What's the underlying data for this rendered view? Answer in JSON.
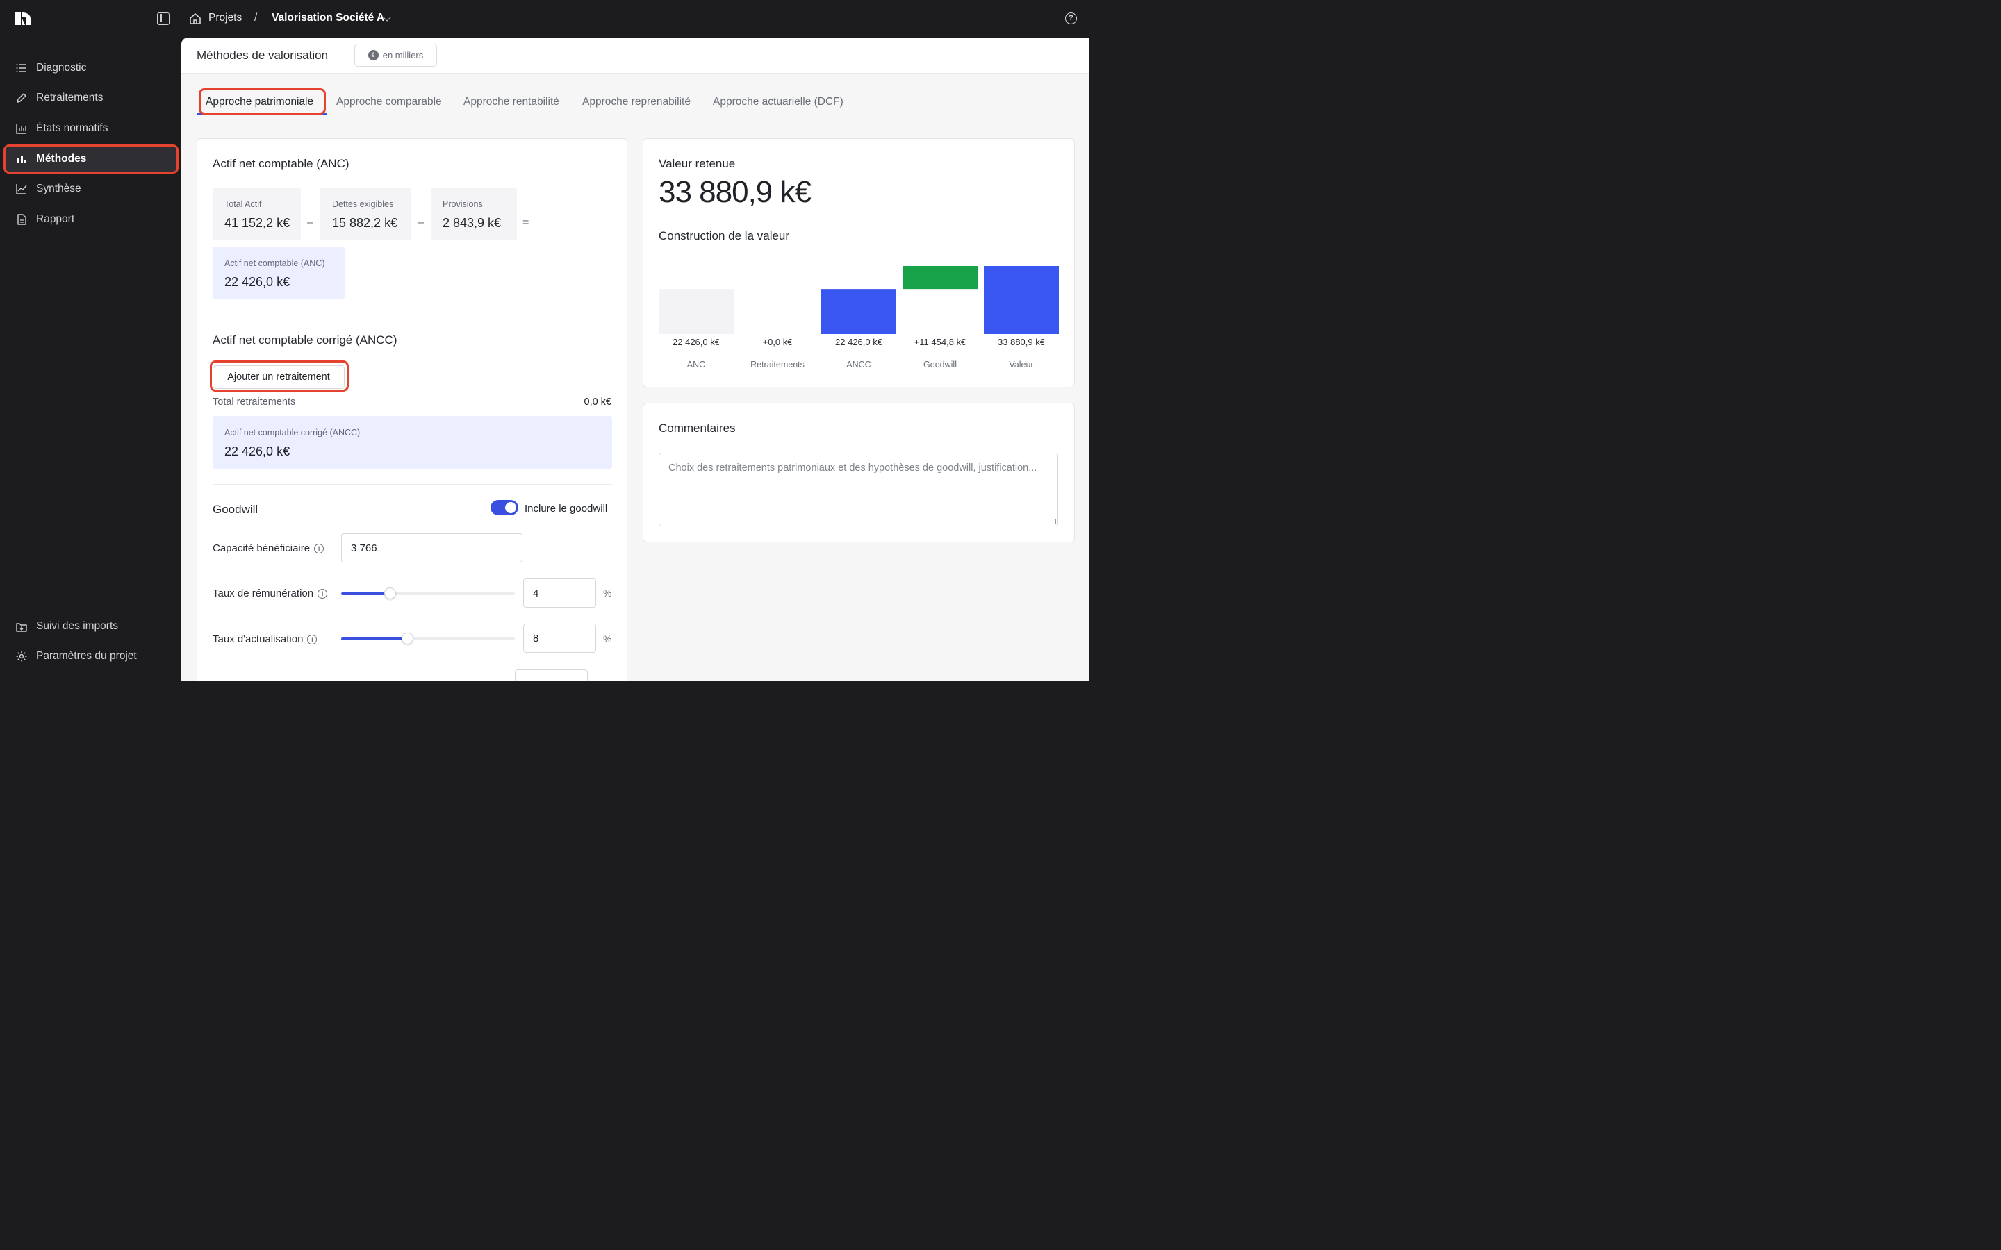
{
  "topbar": {
    "breadcrumb_projects": "Projets",
    "breadcrumb_sep": "/",
    "breadcrumb_current": "Valorisation Société A",
    "help_glyph": "?"
  },
  "sidebar": {
    "items": [
      {
        "label": "Diagnostic",
        "icon": "list-icon"
      },
      {
        "label": "Retraitements",
        "icon": "pencil-icon"
      },
      {
        "label": "États normatifs",
        "icon": "bar-chart-icon"
      },
      {
        "label": "Méthodes",
        "icon": "bar-chart-filled-icon",
        "active": true
      },
      {
        "label": "Synthèse",
        "icon": "line-chart-icon"
      },
      {
        "label": "Rapport",
        "icon": "document-icon"
      }
    ],
    "bottom_items": [
      {
        "label": "Suivi des imports",
        "icon": "import-icon"
      },
      {
        "label": "Paramètres du projet",
        "icon": "gear-icon"
      }
    ]
  },
  "header": {
    "title": "Méthodes de valorisation",
    "unit_symbol": "€",
    "unit_label": "en milliers"
  },
  "tabs": [
    {
      "label": "Approche patrimoniale",
      "active": true
    },
    {
      "label": "Approche comparable"
    },
    {
      "label": "Approche rentabilité"
    },
    {
      "label": "Approche reprenabilité"
    },
    {
      "label": "Approche actuarielle (DCF)"
    }
  ],
  "anc": {
    "title": "Actif net comptable (ANC)",
    "total_actif_label": "Total Actif",
    "total_actif_value": "41 152,2 k€",
    "dettes_label": "Dettes exigibles",
    "dettes_value": "15 882,2 k€",
    "provisions_label": "Provisions",
    "provisions_value": "2 843,9 k€",
    "op_minus": "–",
    "op_equals": "=",
    "result_label": "Actif net comptable (ANC)",
    "result_value": "22 426,0 k€"
  },
  "ancc": {
    "title": "Actif net comptable corrigé (ANCC)",
    "add_button": "Ajouter un retraitement",
    "total_label": "Total retraitements",
    "total_value": "0,0 k€",
    "result_label": "Actif net comptable corrigé (ANCC)",
    "result_value": "22 426,0 k€"
  },
  "goodwill": {
    "title": "Goodwill",
    "toggle_label": "Inclure le goodwill",
    "toggle_on": true,
    "capacite_label": "Capacité bénéficiaire",
    "capacite_value": "3 766",
    "taux_remu_label": "Taux de rémunération",
    "taux_remu_value": "4",
    "taux_remu_fraction": 0.28,
    "taux_actu_label": "Taux d'actualisation",
    "taux_actu_value": "8",
    "taux_actu_fraction": 0.38,
    "percent_sign": "%",
    "info_glyph": "i"
  },
  "valeur": {
    "title": "Valeur retenue",
    "value": "33 880,9 k€",
    "chart_title": "Construction de la valeur"
  },
  "chart_data": {
    "type": "waterfall",
    "title": "Construction de la valeur",
    "categories": [
      "ANC",
      "Retraitements",
      "ANCC",
      "Goodwill",
      "Valeur"
    ],
    "values": [
      22426.0,
      0.0,
      22426.0,
      11454.8,
      33880.9
    ],
    "labels": [
      "22 426,0 k€",
      "+0,0 k€",
      "22 426,0 k€",
      "+11 454,8 k€",
      "33 880,9 k€"
    ],
    "kinds": [
      "base",
      "delta",
      "total",
      "delta",
      "total"
    ],
    "colors": {
      "base": "#f3f3f5",
      "total": "#3a56f0",
      "delta": "#18a34a"
    },
    "ylim": [
      0,
      33880.9
    ]
  },
  "comments": {
    "title": "Commentaires",
    "placeholder": "Choix des retraitements patrimoniaux et des hypothèses de goodwill, justification..."
  }
}
